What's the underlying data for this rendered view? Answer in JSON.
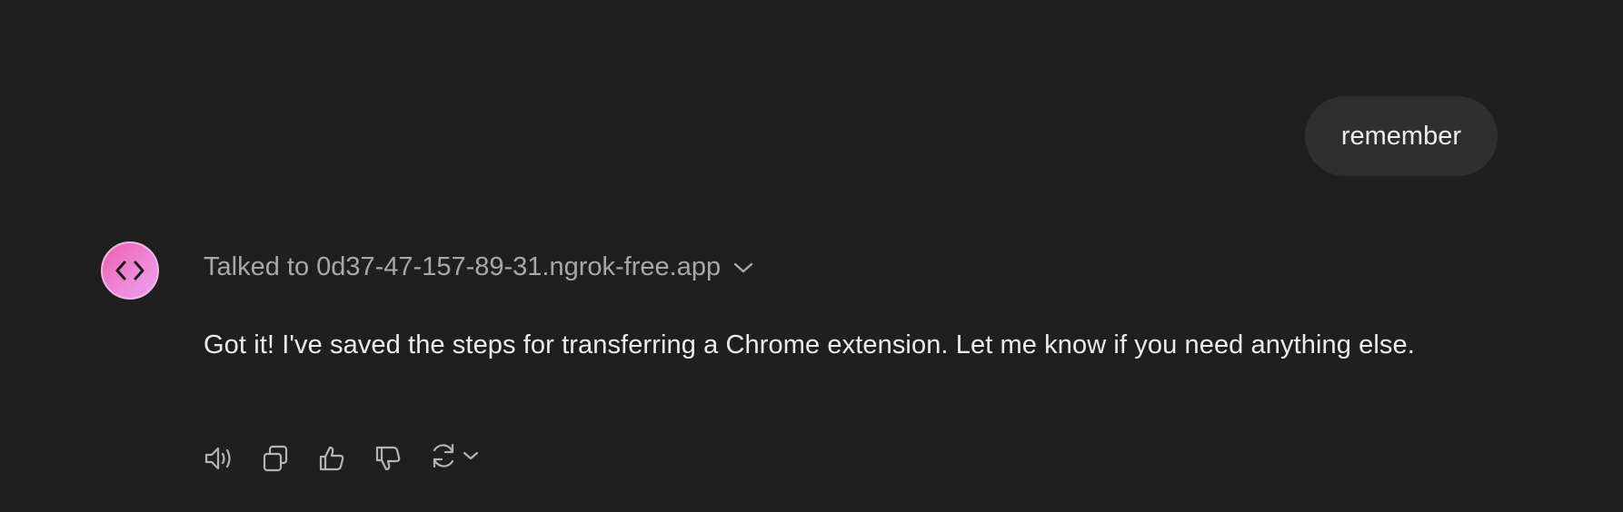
{
  "user_message": {
    "text": "remember"
  },
  "assistant": {
    "avatar_icon": "code-brackets-icon",
    "tool_call": {
      "label": "Talked to 0d37-47-157-89-31.ngrok-free.app",
      "expand_icon": "chevron-down-icon"
    },
    "reply_text": "Got it! I've saved the steps for transferring a Chrome extension. Let me know if you need anything else.",
    "actions": [
      {
        "icon": "speaker-icon"
      },
      {
        "icon": "copy-icon"
      },
      {
        "icon": "thumbs-up-icon"
      },
      {
        "icon": "thumbs-down-icon"
      },
      {
        "icon": "regenerate-icon"
      },
      {
        "icon": "chevron-down-icon"
      }
    ]
  },
  "colors": {
    "background": "#1f1f1f",
    "bubble": "#2f2f2f",
    "text": "#ececec",
    "muted_text": "#a8a8a8",
    "avatar_gradient_start": "#ea5fb0",
    "avatar_gradient_end": "#e7a0f0"
  }
}
